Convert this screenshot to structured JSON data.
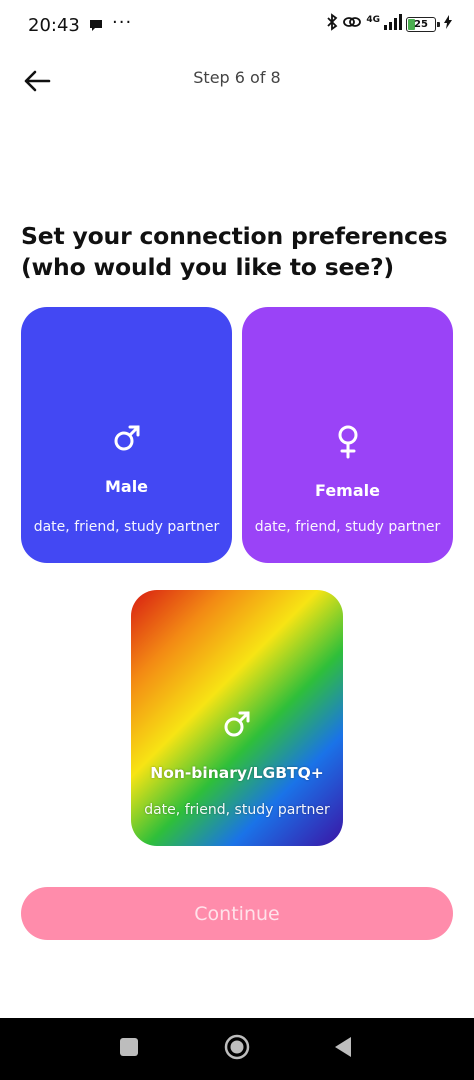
{
  "status_bar": {
    "time": "20:43",
    "overflow": "···",
    "network": "4G",
    "battery_level": "25",
    "battery_percent": 25,
    "icons": [
      "message-icon",
      "bluetooth-icon",
      "link-icon",
      "signal-icon",
      "battery-icon",
      "charging-icon"
    ]
  },
  "header": {
    "step_text": "Step 6 of 8",
    "back_icon": "arrow-left-icon"
  },
  "title": "Set your connection preferences (who would you like to see?)",
  "options": [
    {
      "label": "Male",
      "sub": "date, friend, study partner",
      "icon": "male-symbol-icon",
      "color": "#4348f3"
    },
    {
      "label": "Female",
      "sub": "date, friend, study partner",
      "icon": "female-symbol-icon",
      "color": "#9a43f7"
    },
    {
      "label": "Non-binary/LGBTQ+",
      "sub": "date, friend, study partner",
      "icon": "male-symbol-icon",
      "color": "rainbow-gradient"
    }
  ],
  "continue_label": "Continue",
  "colors": {
    "continue_bg": "#ff8cab",
    "continue_text": "#ffe2ea"
  },
  "nav": {
    "icons": [
      "recents-square-icon",
      "home-circle-icon",
      "back-triangle-icon"
    ]
  }
}
